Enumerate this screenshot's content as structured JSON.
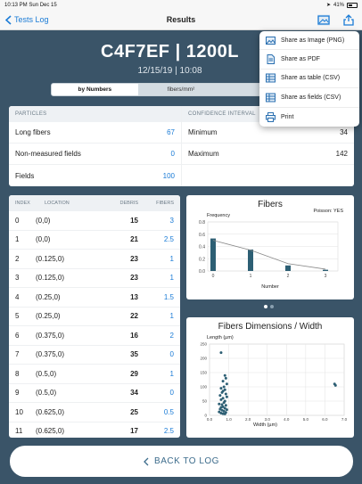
{
  "status": {
    "time": "10:13 PM",
    "date": "Sun Dec 15",
    "battery": "41%"
  },
  "nav": {
    "back_label": "Tests Log",
    "title": "Results"
  },
  "header": {
    "code": "C4F7EF | 1200L",
    "datetime": "12/15/19 | 10:08"
  },
  "segments": [
    "by Numbers",
    "fibers/mm²",
    "f"
  ],
  "particles": {
    "header": "PARTICLES",
    "rows": [
      {
        "label": "Long fibers",
        "value": "67"
      },
      {
        "label": "Non-measured fields",
        "value": "0"
      },
      {
        "label": "Fields",
        "value": "100"
      }
    ]
  },
  "confidence": {
    "header": "CONFIDENCE INTERVAL",
    "rows": [
      {
        "label": "Minimum",
        "value": "34"
      },
      {
        "label": "Maximum",
        "value": "142"
      }
    ]
  },
  "table": {
    "columns": [
      "INDEX",
      "LOCATION",
      "DEBRIS",
      "FIBERS"
    ],
    "rows": [
      [
        "0",
        "(0,0)",
        "15",
        "3"
      ],
      [
        "1",
        "(0,0)",
        "21",
        "2.5"
      ],
      [
        "2",
        "(0.125,0)",
        "23",
        "1"
      ],
      [
        "3",
        "(0.125,0)",
        "23",
        "1"
      ],
      [
        "4",
        "(0.25,0)",
        "13",
        "1.5"
      ],
      [
        "5",
        "(0.25,0)",
        "22",
        "1"
      ],
      [
        "6",
        "(0.375,0)",
        "16",
        "2"
      ],
      [
        "7",
        "(0.375,0)",
        "35",
        "0"
      ],
      [
        "8",
        "(0.5,0)",
        "29",
        "1"
      ],
      [
        "9",
        "(0.5,0)",
        "34",
        "0"
      ],
      [
        "10",
        "(0.625,0)",
        "25",
        "0.5"
      ],
      [
        "11",
        "(0.625,0)",
        "17",
        "2.5"
      ]
    ]
  },
  "fibers_chart": {
    "title": "Fibers",
    "poisson": "Poisson: YES",
    "ylabel": "Frequency",
    "xlabel": "Number"
  },
  "dims_chart": {
    "title": "Fibers Dimensions / Width",
    "ylabel": "Length (µm)",
    "xlabel": "Width (µm)"
  },
  "menu": [
    {
      "label": "Share as Image (PNG)",
      "icon": "image-icon"
    },
    {
      "label": "Share as PDF",
      "icon": "document-icon"
    },
    {
      "label": "Share as table (CSV)",
      "icon": "table-icon"
    },
    {
      "label": "Share as fields (CSV)",
      "icon": "table-icon"
    },
    {
      "label": "Print",
      "icon": "printer-icon"
    }
  ],
  "back_button": "BACK TO LOG",
  "chart_data": [
    {
      "type": "bar",
      "title": "Fibers",
      "xlabel": "Number",
      "ylabel": "Frequency",
      "categories": [
        "0",
        "1",
        "2",
        "3"
      ],
      "series": [
        {
          "values": [
            0.53,
            0.35,
            0.09,
            0.02
          ]
        }
      ],
      "fit_line": [
        0.5,
        0.34,
        0.12,
        0.03
      ],
      "ylim": [
        0,
        0.8
      ],
      "yticks": [
        "0.0",
        "0.2",
        "0.4",
        "0.6",
        "0.8"
      ]
    },
    {
      "type": "scatter",
      "title": "Fibers Dimensions / Width",
      "xlabel": "Width (µm)",
      "ylabel": "Length (µm)",
      "xlim": [
        0,
        7
      ],
      "ylim": [
        0,
        250
      ],
      "xticks": [
        "0.0",
        "1.0",
        "2.0",
        "3.0",
        "4.0",
        "5.0",
        "6.0",
        "7.0"
      ],
      "yticks": [
        "0",
        "50",
        "100",
        "150",
        "200",
        "250"
      ],
      "points": [
        [
          0.6,
          220
        ],
        [
          0.8,
          140
        ],
        [
          0.85,
          130
        ],
        [
          0.7,
          120
        ],
        [
          0.9,
          110
        ],
        [
          0.75,
          100
        ],
        [
          0.6,
          95
        ],
        [
          0.8,
          90
        ],
        [
          0.7,
          85
        ],
        [
          0.65,
          80
        ],
        [
          0.85,
          75
        ],
        [
          0.55,
          70
        ],
        [
          0.9,
          65
        ],
        [
          0.7,
          60
        ],
        [
          0.6,
          55
        ],
        [
          0.8,
          50
        ],
        [
          0.75,
          45
        ],
        [
          0.5,
          40
        ],
        [
          0.65,
          38
        ],
        [
          0.85,
          35
        ],
        [
          0.7,
          30
        ],
        [
          0.6,
          28
        ],
        [
          0.8,
          25
        ],
        [
          0.55,
          22
        ],
        [
          0.9,
          20
        ],
        [
          0.65,
          18
        ],
        [
          0.75,
          15
        ],
        [
          0.5,
          12
        ],
        [
          0.85,
          10
        ],
        [
          0.6,
          8
        ],
        [
          0.7,
          6
        ],
        [
          0.8,
          5
        ],
        [
          6.5,
          110
        ],
        [
          6.55,
          105
        ]
      ]
    }
  ]
}
